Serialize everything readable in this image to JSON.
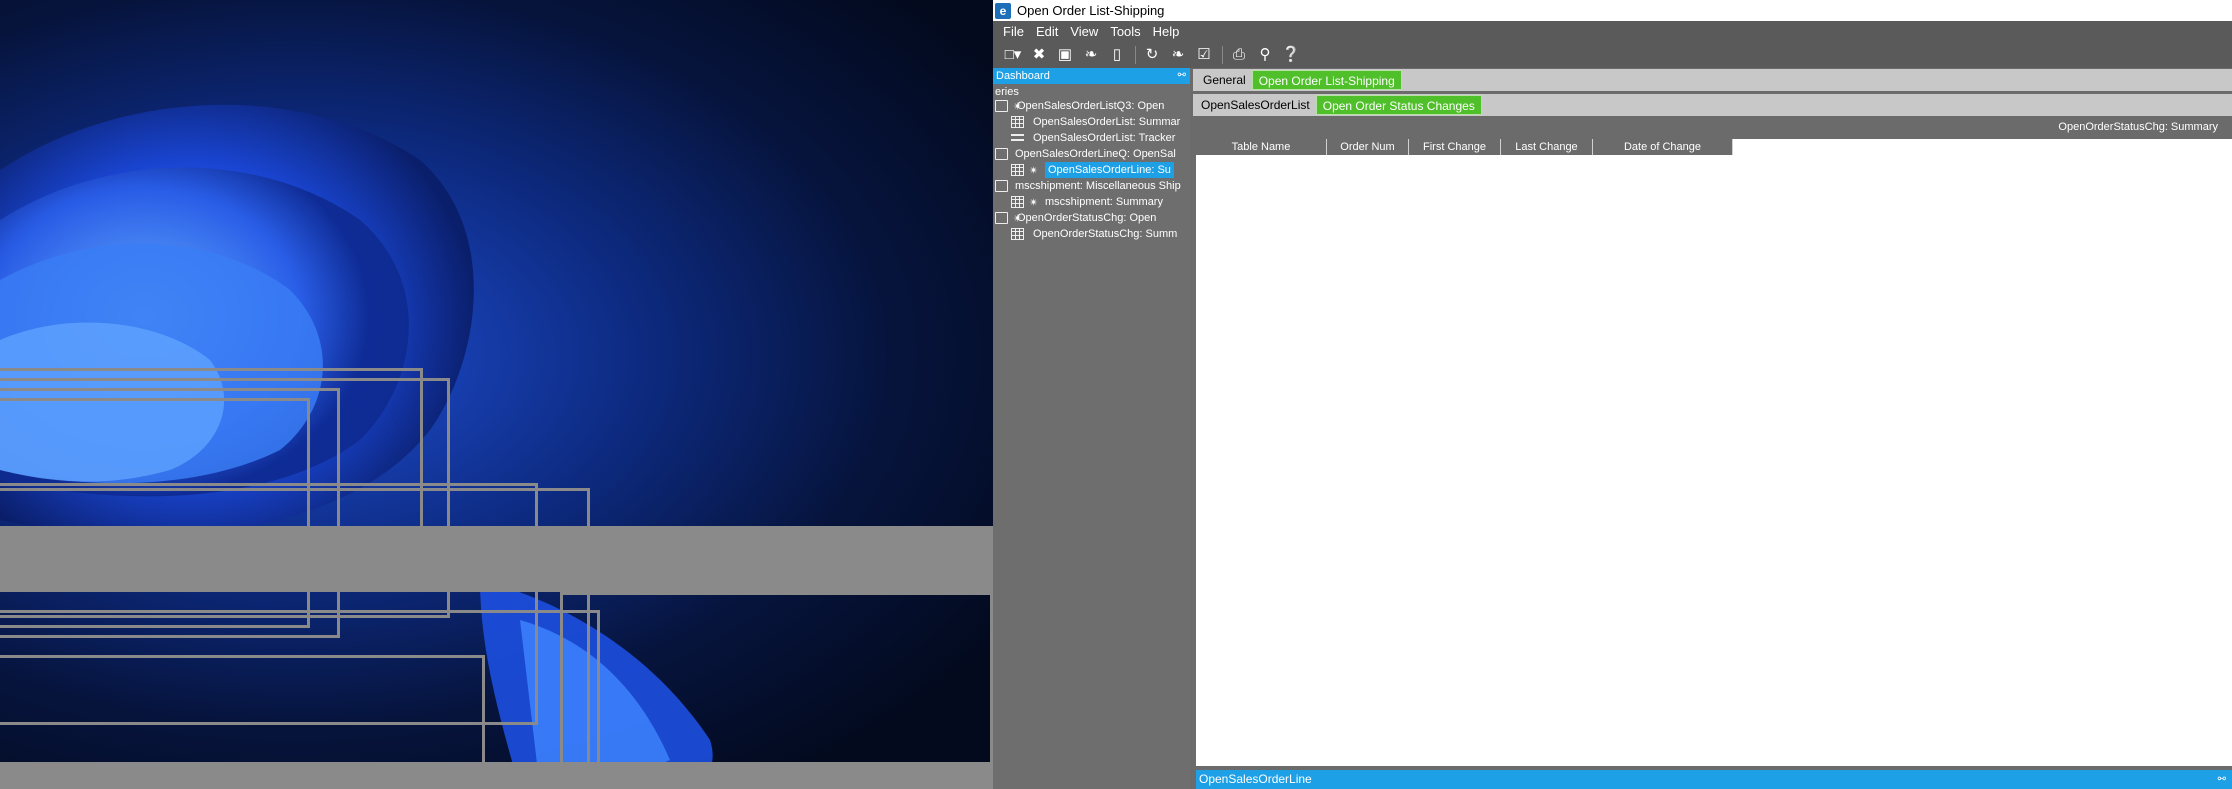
{
  "window": {
    "title": "Open Order List-Shipping",
    "logo_letter": "e"
  },
  "menu": [
    "File",
    "Edit",
    "View",
    "Tools",
    "Help"
  ],
  "toolbar": {
    "icons": [
      "new-icon",
      "delete-icon",
      "save-icon",
      "clear-icon",
      "attach-icon",
      "refresh-icon",
      "broom-icon",
      "checklist-icon",
      "print-icon",
      "print-preview-icon",
      "help-icon"
    ]
  },
  "tree": {
    "header": "Dashboard",
    "root": "eries",
    "items": [
      {
        "label": "OpenSalesOrderListQ3: Open",
        "icon": "query-icon",
        "indent": 0,
        "sat": true
      },
      {
        "label": "OpenSalesOrderList: Summar",
        "icon": "grid-icon",
        "indent": 1,
        "sat": false
      },
      {
        "label": "OpenSalesOrderList: Tracker",
        "icon": "tracker-icon",
        "indent": 1,
        "sat": false
      },
      {
        "label": "OpenSalesOrderLineQ: OpenSal",
        "icon": "query-icon",
        "indent": 0,
        "sat": false
      },
      {
        "label": "OpenSalesOrderLine: Su",
        "icon": "grid-icon",
        "indent": 1,
        "sat": true,
        "selected": true
      },
      {
        "label": "mscshipment: Miscellaneous Ship",
        "icon": "query-icon",
        "indent": 0,
        "sat": false
      },
      {
        "label": "mscshipment: Summary",
        "icon": "grid-icon",
        "indent": 1,
        "sat": true
      },
      {
        "label": "OpenOrderStatusChg: Open",
        "icon": "query-icon",
        "indent": 0,
        "sat": true
      },
      {
        "label": "OpenOrderStatusChg: Summ",
        "icon": "grid-icon",
        "indent": 1,
        "sat": false
      }
    ]
  },
  "tabs_top": [
    "General",
    "Open Order List-Shipping"
  ],
  "tabs_sub": [
    "OpenSalesOrderList",
    "Open Order Status Changes"
  ],
  "panel_title": "OpenOrderStatusChg: Summary",
  "grid": {
    "columns": [
      "Table Name",
      "Order Num",
      "First Change",
      "Last Change",
      "Date of Change"
    ]
  },
  "status_bar": "OpenSalesOrderLine",
  "colors": {
    "accent_blue": "#1ea0e6",
    "tab_active_green": "#4fbf2a"
  }
}
